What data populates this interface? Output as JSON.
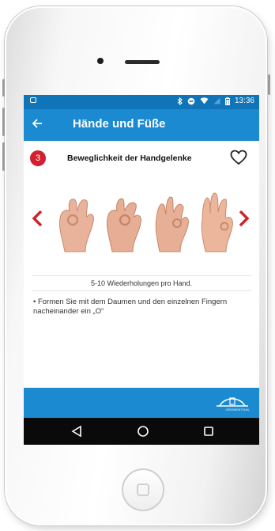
{
  "status_bar": {
    "time": "13:36"
  },
  "app_bar": {
    "title": "Hände und Füße"
  },
  "exercise": {
    "number": "3",
    "title": "Beweglichkeit der Handgelenke"
  },
  "caption": "5-10 Wiederholungen pro Hand.",
  "description": "• Formen Sie mit dem Daumen und den einzelnen Fingern nacheinander ein „O“",
  "footer": {
    "logo_text": "GRÜNENTHAL"
  },
  "colors": {
    "status_bar": "#0f74b8",
    "app_bar": "#1b8ad0",
    "badge": "#d2202f",
    "arrow": "#d2202f",
    "nav_bar": "#0a0a0a"
  },
  "icons": [
    "back-arrow-icon",
    "bluetooth-icon",
    "dnd-icon",
    "wifi-icon",
    "signal-icon",
    "battery-icon",
    "heart-icon",
    "chevron-left-icon",
    "chevron-right-icon",
    "nav-back-icon",
    "nav-home-icon",
    "nav-recents-icon"
  ]
}
